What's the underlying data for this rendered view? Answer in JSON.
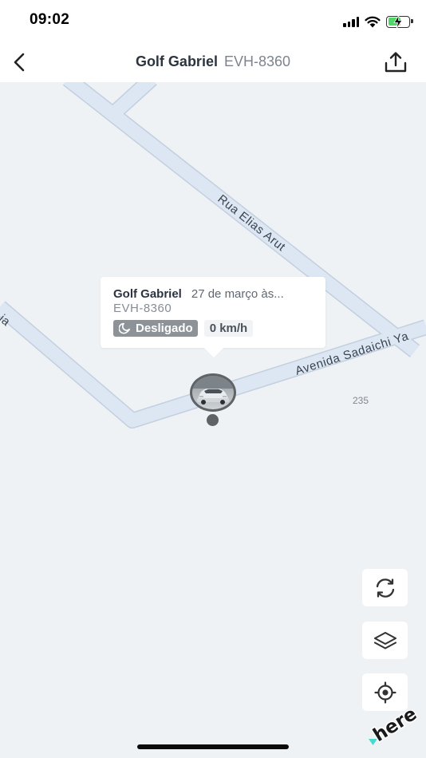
{
  "status_bar": {
    "time": "09:02"
  },
  "header": {
    "vehicle_name": "Golf Gabriel",
    "plate": "EVH-8360",
    "back_icon": "chevron-left-icon",
    "share_icon": "share-upload-icon"
  },
  "map": {
    "streets": [
      {
        "name": "Rua Elias Arut"
      },
      {
        "name": "Avenida Sadaichi Ya"
      },
      {
        "name": "ia"
      }
    ],
    "poi_number": "235",
    "brand": "here"
  },
  "popup": {
    "name": "Golf Gabriel",
    "date": "27 de março às...",
    "plate": "EVH-8360",
    "status": "Desligado",
    "status_icon": "moon-icon",
    "speed": "0 km/h"
  },
  "map_controls": [
    {
      "icon": "refresh-icon"
    },
    {
      "icon": "layers-icon"
    },
    {
      "icon": "locate-icon"
    }
  ],
  "colors": {
    "map_background": "#eef2f4",
    "road_fill": "#dde6f3",
    "road_edge": "#c3cfdf",
    "status_badge": "#8c9297",
    "battery_fill": "#4cd964"
  }
}
